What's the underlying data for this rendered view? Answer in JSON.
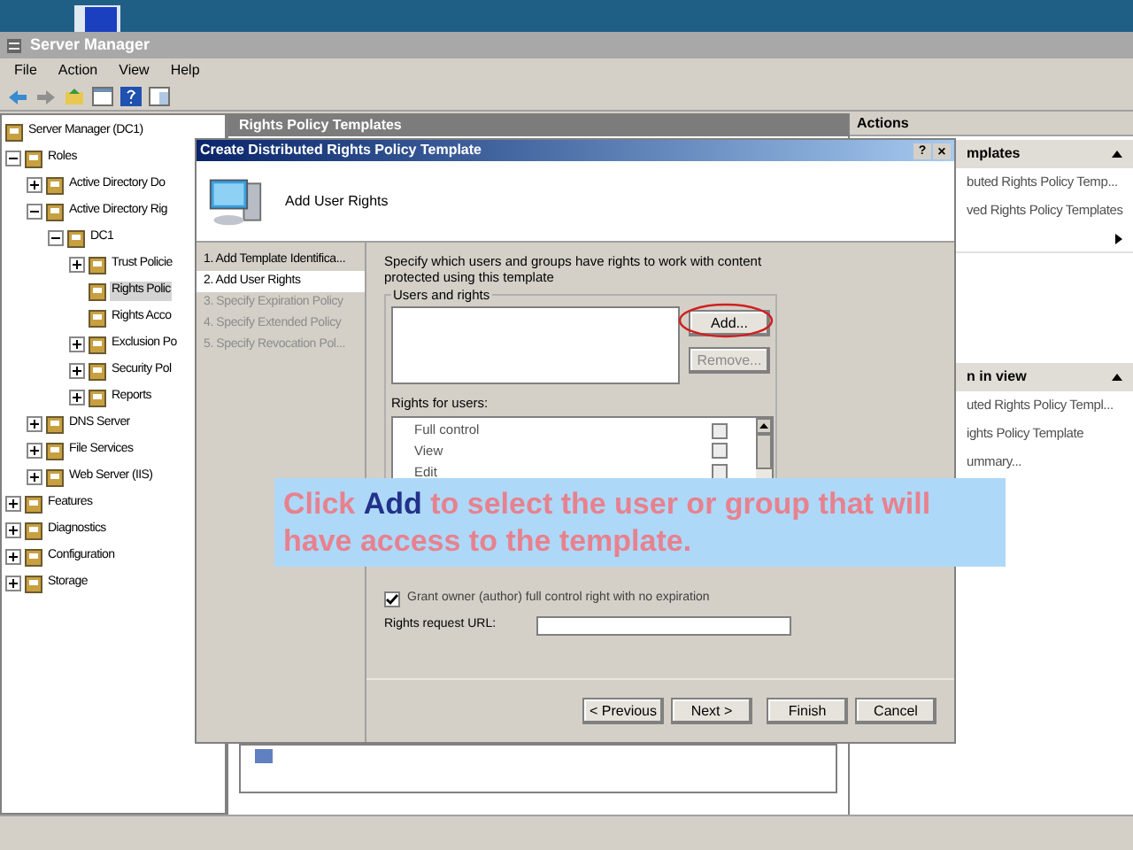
{
  "window": {
    "title": "Server Manager"
  },
  "menu": [
    "File",
    "Action",
    "View",
    "Help"
  ],
  "tree": [
    {
      "label": "Server Manager (DC1)",
      "selected": false,
      "children": [
        {
          "label": "Roles",
          "expanded": true,
          "selected": false,
          "children": [
            {
              "label": "Active Directory Do",
              "expanded": false,
              "selected": false
            },
            {
              "label": "Active Directory Rig",
              "expanded": true,
              "selected": false,
              "children": [
                {
                  "label": "DC1",
                  "expanded": true,
                  "selected": false,
                  "children": [
                    {
                      "label": "Trust Policie",
                      "expanded": false,
                      "selected": false
                    },
                    {
                      "label": "Rights Polic",
                      "selected": true
                    },
                    {
                      "label": "Rights Acco",
                      "selected": false
                    },
                    {
                      "label": "Exclusion Po",
                      "expanded": false,
                      "selected": false
                    },
                    {
                      "label": "Security Pol",
                      "expanded": false,
                      "selected": false
                    },
                    {
                      "label": "Reports",
                      "expanded": false,
                      "selected": false
                    }
                  ]
                }
              ]
            },
            {
              "label": "DNS Server",
              "expanded": false,
              "selected": false
            },
            {
              "label": "File Services",
              "expanded": false,
              "selected": false
            },
            {
              "label": "Web Server (IIS)",
              "expanded": false,
              "selected": false
            }
          ]
        },
        {
          "label": "Features",
          "expanded": false,
          "selected": false
        },
        {
          "label": "Diagnostics",
          "expanded": false,
          "selected": false
        },
        {
          "label": "Configuration",
          "expanded": false,
          "selected": false
        },
        {
          "label": "Storage",
          "expanded": false,
          "selected": false
        }
      ]
    }
  ],
  "center": {
    "title": "Rights Policy Templates"
  },
  "actions": {
    "title": "Actions",
    "sections": [
      {
        "heading": "mplates",
        "items": [
          {
            "label": "buted Rights Policy Temp...",
            "kind": "link"
          },
          {
            "label": "ved Rights Policy Templates",
            "kind": "link"
          },
          {
            "kind": "submenu"
          }
        ]
      },
      {
        "heading": "n in view",
        "items": [
          {
            "label": "uted Rights Policy Templ...",
            "kind": "link"
          },
          {
            "label": "ights Policy Template",
            "kind": "link"
          },
          {
            "label": "ummary...",
            "kind": "link"
          }
        ]
      }
    ]
  },
  "dialog": {
    "title": "Create Distributed Rights Policy Template",
    "help": "?",
    "close": "×",
    "header": "Add User Rights",
    "steps": [
      {
        "label": "1. Add Template Identifica...",
        "selected": false,
        "disabled": false
      },
      {
        "label": "2. Add User Rights",
        "selected": true,
        "disabled": false
      },
      {
        "label": "3. Specify Expiration Policy",
        "selected": false,
        "disabled": true
      },
      {
        "label": "4. Specify Extended Policy",
        "selected": false,
        "disabled": true
      },
      {
        "label": "5. Specify Revocation Pol...",
        "selected": false,
        "disabled": true
      }
    ],
    "description": "Specify which users and groups have rights to work with content protected using this template",
    "users_group": "Users and rights",
    "add_button": {
      "label": "Add...",
      "disabled": false
    },
    "remove_button": {
      "label": "Remove...",
      "disabled": true
    },
    "rights_label": "Rights for users:",
    "rights": [
      {
        "label": "Full control",
        "checked": false
      },
      {
        "label": "View",
        "checked": false
      },
      {
        "label": "Edit",
        "checked": false
      }
    ],
    "grant_owner": {
      "label": "Grant owner (author) full control right with no expiration",
      "checked": true
    },
    "url_label": "Rights request URL:",
    "buttons": [
      "< Previous",
      "Next >",
      "Finish",
      "Cancel"
    ]
  },
  "callout": "Click **Add** to select the user or group that will have access to the template."
}
